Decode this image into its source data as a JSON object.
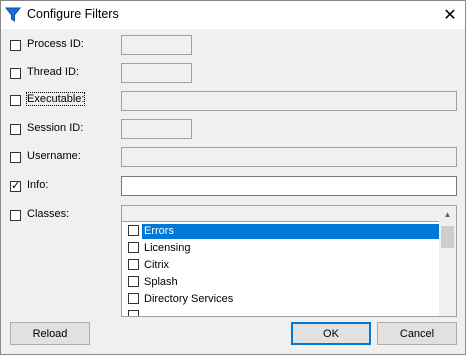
{
  "window": {
    "title": "Configure Filters",
    "close_glyph": "✕",
    "icon": "filter-icon",
    "icon_color": "#1e6fd6"
  },
  "filters": [
    {
      "key": "process_id",
      "label": "Process ID:",
      "checked": false,
      "value": ""
    },
    {
      "key": "thread_id",
      "label": "Thread ID:",
      "checked": false,
      "value": ""
    },
    {
      "key": "executable",
      "label": "Executable:",
      "checked": false,
      "value": ""
    },
    {
      "key": "session_id",
      "label": "Session ID:",
      "checked": false,
      "value": ""
    },
    {
      "key": "username",
      "label": "Username:",
      "checked": false,
      "value": ""
    },
    {
      "key": "info",
      "label": "Info:",
      "checked": true,
      "value": ""
    },
    {
      "key": "classes",
      "label": "Classes:",
      "checked": false
    }
  ],
  "classes_list": [
    {
      "label": "Errors",
      "checked": false,
      "selected": true
    },
    {
      "label": "Licensing",
      "checked": false,
      "selected": false
    },
    {
      "label": "Citrix",
      "checked": false,
      "selected": false
    },
    {
      "label": "Splash",
      "checked": false,
      "selected": false
    },
    {
      "label": "Directory Services",
      "checked": false,
      "selected": false
    }
  ],
  "buttons": {
    "reload": "Reload",
    "ok": "OK",
    "cancel": "Cancel"
  },
  "colors": {
    "selection": "#0078d7",
    "default_button_border": "#0078d7"
  }
}
